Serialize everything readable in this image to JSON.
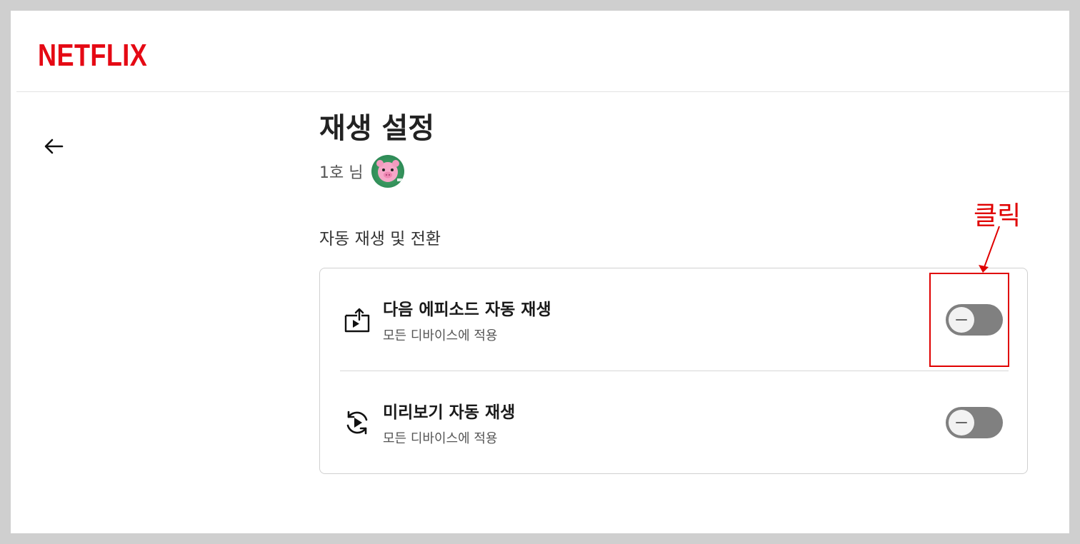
{
  "header": {
    "logo_text": "NETFLIX",
    "brand_color": "#e50914"
  },
  "page": {
    "title": "재생 설정",
    "profile_name": "1호 님",
    "section_title": "자동 재생 및 전환"
  },
  "settings": [
    {
      "title": "다음 에피소드 자동 재생",
      "subtitle": "모든 디바이스에 적용",
      "icon": "next-episode-play-icon",
      "toggle_on": false
    },
    {
      "title": "미리보기 자동 재생",
      "subtitle": "모든 디바이스에 적용",
      "icon": "preview-autoplay-icon",
      "toggle_on": false
    }
  ],
  "annotation": {
    "label": "클릭",
    "color": "#e00000"
  },
  "icons": {
    "back": "arrow-left-icon",
    "avatar": "pig-avatar-icon"
  }
}
